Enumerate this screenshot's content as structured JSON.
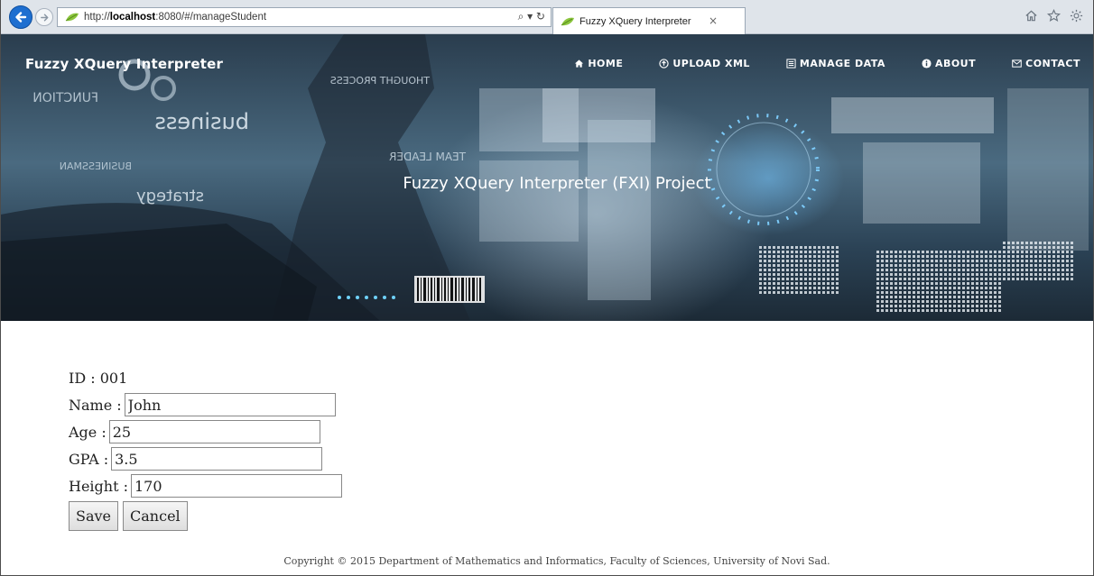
{
  "browser": {
    "url_prefix": "http://",
    "url_host": "localhost",
    "url_rest": ":8080/#/manageStudent",
    "tab_title": "Fuzzy XQuery Interpreter",
    "tab_close": "×",
    "search_icon": "⌕ ▾ ↻"
  },
  "header": {
    "brand": "Fuzzy XQuery Interpreter",
    "nav": [
      {
        "icon": "home-icon",
        "label": "HOME"
      },
      {
        "icon": "upload-icon",
        "label": "UPLOAD XML"
      },
      {
        "icon": "list-icon",
        "label": "MANAGE DATA"
      },
      {
        "icon": "info-icon",
        "label": "ABOUT"
      },
      {
        "icon": "envelope-icon",
        "label": "CONTACT"
      }
    ],
    "hero_title": "Fuzzy XQuery Interpreter (FXI) Project"
  },
  "form": {
    "id_label": "ID : 001",
    "name_label": "Name :",
    "name_value": "John",
    "age_label": "Age :",
    "age_value": "25",
    "gpa_label": "GPA :",
    "gpa_value": "3.5",
    "height_label": "Height :",
    "height_value": "170",
    "save_label": "Save",
    "cancel_label": "Cancel"
  },
  "footer": {
    "copyright": "Copyright © 2015 Department of Mathematics and Informatics, Faculty of Sciences, University of Novi Sad."
  },
  "colors": {
    "nav_back": "#1e6fd0",
    "banner_dark": "#2a3d4e",
    "banner_glow": "#78c8ff"
  }
}
